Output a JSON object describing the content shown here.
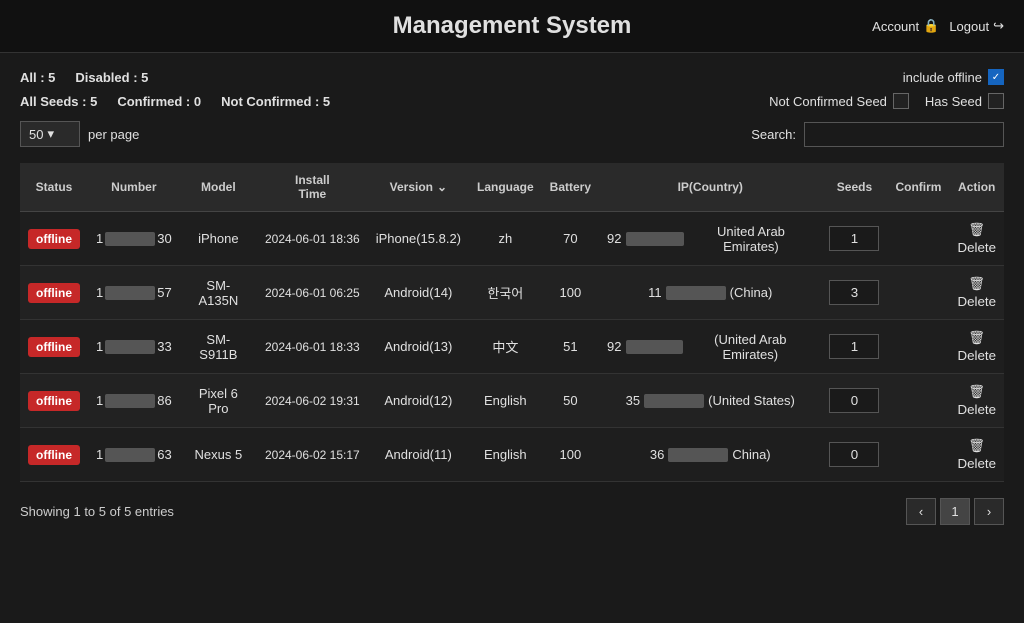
{
  "header": {
    "title": "Management System",
    "account_label": "Account",
    "logout_label": "Logout"
  },
  "filters": {
    "all_label": "All : 5",
    "disabled_label": "Disabled : 5",
    "include_offline_label": "include offline",
    "include_offline_checked": true,
    "all_seeds_label": "All Seeds : 5",
    "confirmed_label": "Confirmed : 0",
    "not_confirmed_label": "Not Confirmed : 5",
    "not_confirmed_seed_label": "Not Confirmed Seed",
    "has_seed_label": "Has Seed"
  },
  "per_page": {
    "value": "50",
    "label": "per page",
    "search_label": "Search:"
  },
  "table": {
    "headers": [
      "Status",
      "Number",
      "Model",
      "Install Time",
      "Version",
      "Language",
      "Battery",
      "IP(Country)",
      "Seeds",
      "Confirm",
      "Action"
    ],
    "rows": [
      {
        "status": "offline",
        "number_prefix": "1",
        "number_suffix": "30",
        "model": "iPhone",
        "install_time": "2024-06-01 18:36",
        "version": "iPhone(15.8.2)",
        "language": "zh",
        "battery": "70",
        "ip_prefix": "92",
        "country": "United Arab Emirates)",
        "seeds": "1",
        "confirm": "",
        "action": "Delete"
      },
      {
        "status": "offline",
        "number_prefix": "1",
        "number_suffix": "57",
        "model": "SM-A135N",
        "install_time": "2024-06-01 06:25",
        "version": "Android(14)",
        "language": "한국어",
        "battery": "100",
        "ip_prefix": "11",
        "country": "(China)",
        "seeds": "3",
        "confirm": "",
        "action": "Delete"
      },
      {
        "status": "offline",
        "number_prefix": "1",
        "number_suffix": "33",
        "model": "SM-S911B",
        "install_time": "2024-06-01 18:33",
        "version": "Android(13)",
        "language": "中文",
        "battery": "51",
        "ip_prefix": "92",
        "country": "(United Arab Emirates)",
        "seeds": "1",
        "confirm": "",
        "action": "Delete"
      },
      {
        "status": "offline",
        "number_prefix": "1",
        "number_suffix": "86",
        "model": "Pixel 6 Pro",
        "install_time": "2024-06-02 19:31",
        "version": "Android(12)",
        "language": "English",
        "battery": "50",
        "ip_prefix": "35",
        "country": "(United States)",
        "seeds": "0",
        "confirm": "",
        "action": "Delete"
      },
      {
        "status": "offline",
        "number_prefix": "1",
        "number_suffix": "63",
        "model": "Nexus 5",
        "install_time": "2024-06-02 15:17",
        "version": "Android(11)",
        "language": "English",
        "battery": "100",
        "ip_prefix": "36",
        "country": "China)",
        "seeds": "0",
        "confirm": "",
        "action": "Delete"
      }
    ]
  },
  "pagination": {
    "info": "Showing 1 to 5 of 5 entries",
    "current_page": "1"
  }
}
